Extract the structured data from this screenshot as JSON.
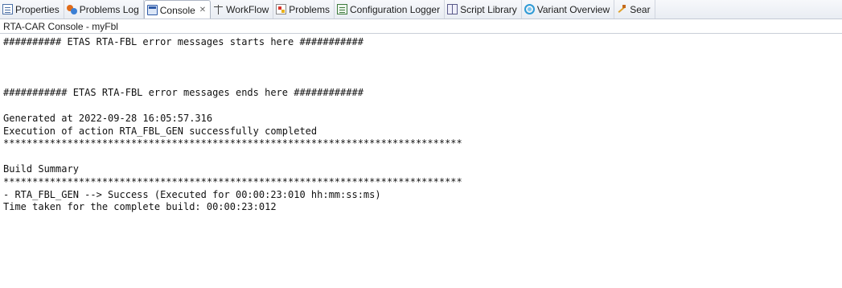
{
  "tabs": [
    {
      "label": "Properties",
      "icon": "properties-icon"
    },
    {
      "label": "Problems Log",
      "icon": "problems-log-icon"
    },
    {
      "label": "Console",
      "icon": "console-icon",
      "active": true,
      "close": "✕"
    },
    {
      "label": "WorkFlow",
      "icon": "workflow-icon"
    },
    {
      "label": "Problems",
      "icon": "problems-icon"
    },
    {
      "label": "Configuration Logger",
      "icon": "configuration-logger-icon"
    },
    {
      "label": "Script Library",
      "icon": "script-library-icon"
    },
    {
      "label": "Variant Overview",
      "icon": "variant-overview-icon"
    },
    {
      "label": "Sear",
      "icon": "search-icon"
    }
  ],
  "console_title": "RTA-CAR Console - myFbl",
  "console_lines": [
    "########## ETAS RTA-FBL error messages starts here ###########",
    "",
    "",
    "",
    "########### ETAS RTA-FBL error messages ends here ############",
    "",
    "Generated at 2022-09-28 16:05:57.316",
    "Execution of action RTA_FBL_GEN successfully completed",
    "*******************************************************************************",
    "",
    "Build Summary",
    "*******************************************************************************",
    "- RTA_FBL_GEN --> Success (Executed for 00:00:23:010 hh:mm:ss:ms)",
    "Time taken for the complete build: 00:00:23:012"
  ]
}
